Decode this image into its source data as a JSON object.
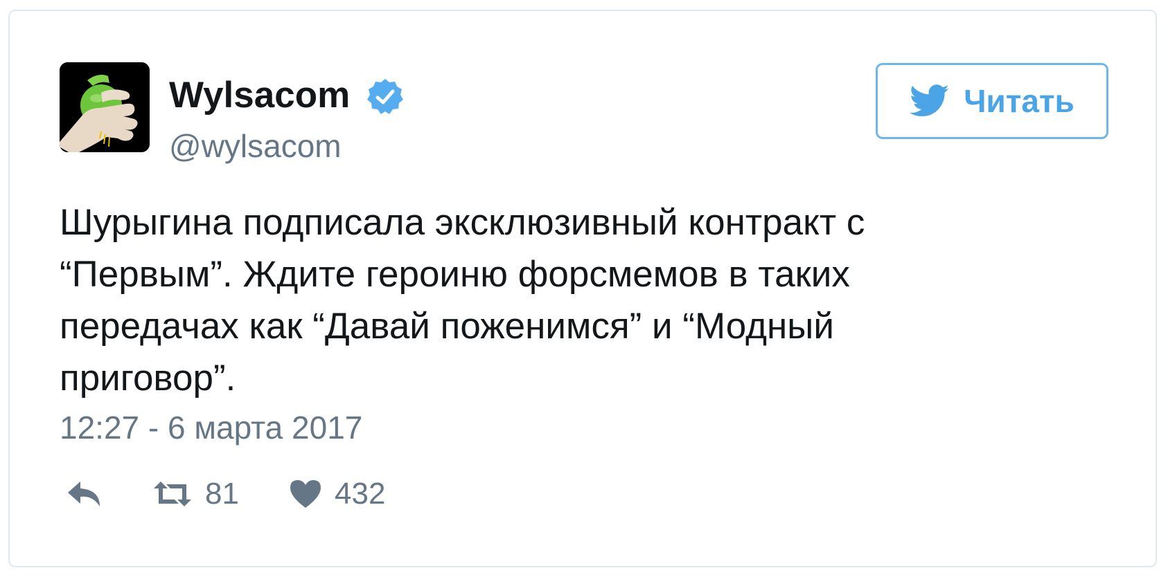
{
  "author": {
    "display_name": "Wylsacom",
    "handle": "@wylsacom",
    "verified": true
  },
  "follow_button": {
    "label": "Читать",
    "icon": "twitter-bird-icon"
  },
  "tweet": {
    "text_lines": [
      "Шурыгина подписала эксклюзивный контракт с",
      "“Первым”. Ждите героиню форсмемов в таких",
      "передачах как “Давай поженимся” и “Модный",
      "приговор”."
    ],
    "timestamp": "12:27 - 6 марта 2017"
  },
  "actions": {
    "reply_icon": "reply-icon",
    "retweet_icon": "retweet-icon",
    "retweet_count": "81",
    "like_icon": "heart-icon",
    "like_count": "432"
  },
  "colors": {
    "text": "#14171a",
    "secondary": "#657786",
    "accent": "#4aa4e6",
    "verified": "#55acee",
    "border": "#e1e8ed"
  }
}
